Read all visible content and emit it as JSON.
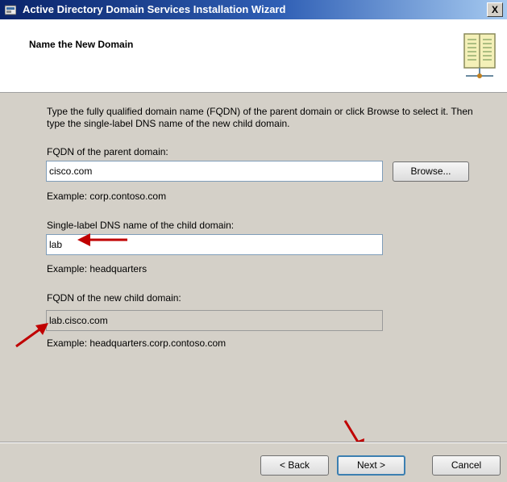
{
  "window": {
    "title": "Active Directory Domain Services Installation Wizard",
    "close_label": "X"
  },
  "header": {
    "title": "Name the New Domain"
  },
  "content": {
    "instructions": "Type the fully qualified domain name (FQDN) of the parent domain or click Browse to select it. Then type the single-label DNS name of the new child domain.",
    "parent_label": "FQDN of the parent domain:",
    "parent_value": "cisco.com",
    "browse_label": "Browse...",
    "parent_example": "Example: corp.contoso.com",
    "child_label": "Single-label DNS name of the child domain:",
    "child_value": "lab",
    "child_example": "Example: headquarters",
    "newchild_label": "FQDN of the new child domain:",
    "newchild_value": "lab.cisco.com",
    "newchild_example": "Example: headquarters.corp.contoso.com"
  },
  "footer": {
    "back_label": "< Back",
    "next_label": "Next >",
    "cancel_label": "Cancel"
  },
  "colors": {
    "annotation_arrow": "#c00000",
    "dialog_face": "#d4d0c8",
    "titlebar": "#0a246a"
  },
  "icons": [
    "wizard-app-icon",
    "close-icon",
    "directory-book-icon",
    "annotation-arrow-icon"
  ]
}
